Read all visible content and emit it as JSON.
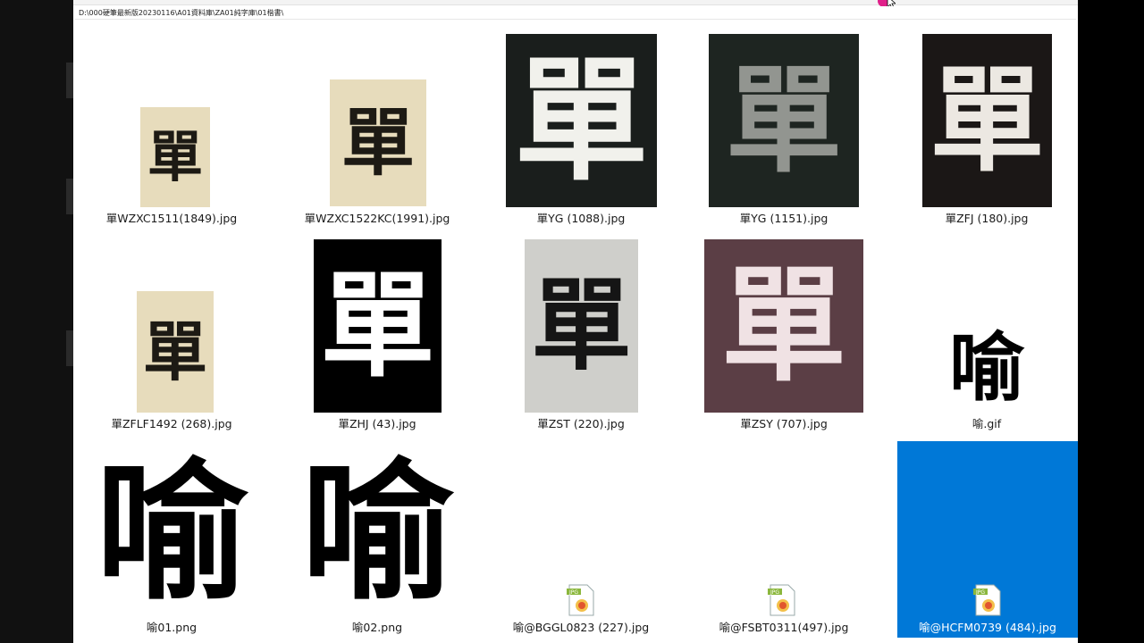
{
  "window": {
    "path": "D:\\000硬筆最新版20230116\\A01資料庫\\ZA01純字庫\\01楷書\\"
  },
  "colors": {
    "selection": "#0078d7",
    "window_bg": "#ffffff",
    "text": "#1a1a1a"
  },
  "files": [
    {
      "name": "單WZXC1511(1849).jpg",
      "char": "單"
    },
    {
      "name": "單WZXC1522KC(1991).jpg",
      "char": "單"
    },
    {
      "name": "單YG (1088).jpg",
      "char": "單"
    },
    {
      "name": "單YG (1151).jpg",
      "char": "單"
    },
    {
      "name": "單ZFJ (180).jpg",
      "char": "單"
    },
    {
      "name": "單ZFLF1492 (268).jpg",
      "char": "單"
    },
    {
      "name": "單ZHJ (43).jpg",
      "char": "單"
    },
    {
      "name": "單ZST (220).jpg",
      "char": "單"
    },
    {
      "name": "單ZSY (707).jpg",
      "char": "單"
    },
    {
      "name": "喻.gif",
      "char": "喻"
    },
    {
      "name": "喻01.png",
      "char": "喻"
    },
    {
      "name": "喻02.png",
      "char": "喻"
    },
    {
      "name": "喻@BGGL0823 (227).jpg",
      "icon": "jpg-file-icon"
    },
    {
      "name": "喻@FSBT0311(497).jpg",
      "icon": "jpg-file-icon"
    },
    {
      "name": "喻@HCFM0739 (484).jpg",
      "icon": "jpg-file-icon",
      "selected": true
    }
  ]
}
